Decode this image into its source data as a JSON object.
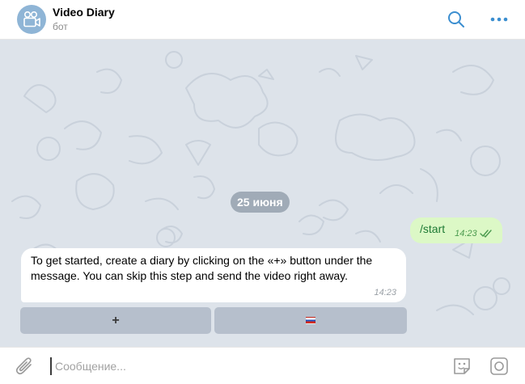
{
  "header": {
    "title": "Video Diary",
    "subtitle": "бот",
    "avatar_icon": "film-camera-icon",
    "search_icon": "search-icon",
    "more_icon": "more-dots-icon"
  },
  "chat": {
    "date_label": "25 июня",
    "outgoing": {
      "text": "/start",
      "time": "14:23",
      "status_icon": "double-check-icon"
    },
    "incoming": {
      "text": "To get started, create a diary by clicking on the «+» button under the message. You can skip this step and send the video right away.",
      "time": "14:23"
    },
    "keyboard": [
      {
        "label": "+"
      },
      {
        "label": "",
        "icon": "russia-flag-icon"
      }
    ]
  },
  "composer": {
    "placeholder": "Сообщение...",
    "value": "",
    "attach_icon": "paperclip-icon",
    "sticker_icon": "sticker-icon",
    "camera_icon": "camera-icon"
  },
  "colors": {
    "accent": "#3b8ed0",
    "chat_background": "#dde3ea",
    "outgoing_bubble": "#dcf8c6",
    "outgoing_text": "#1e7a35"
  }
}
